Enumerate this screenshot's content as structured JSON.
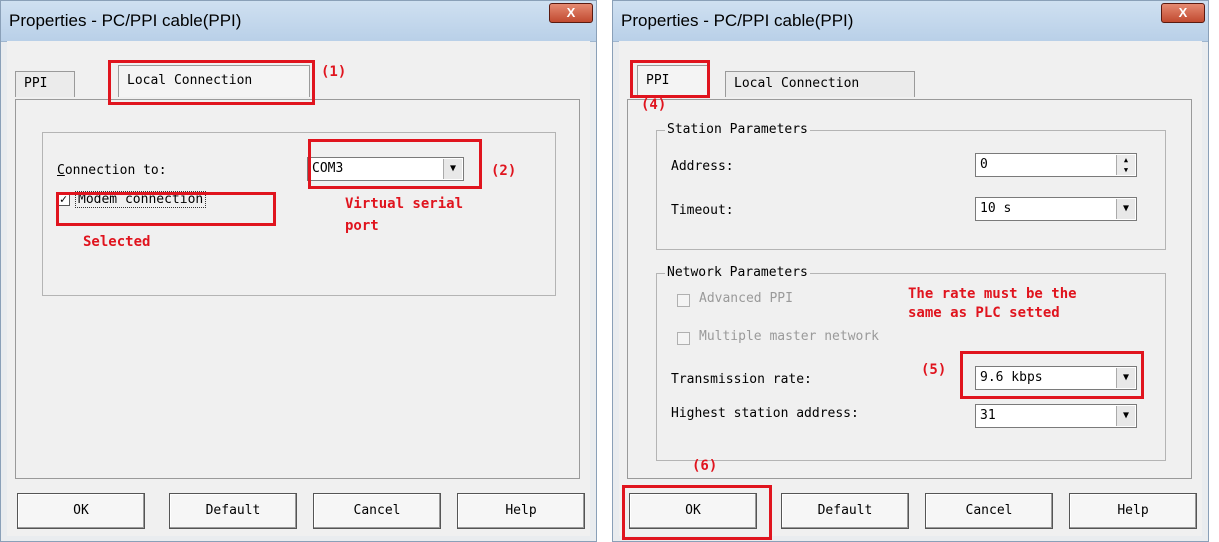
{
  "left_dialog": {
    "title": "Properties - PC/PPI cable(PPI)",
    "close_glyph": "X",
    "tabs": [
      {
        "label": "PPI"
      },
      {
        "label": "Local Connection"
      }
    ],
    "connection_to_label": "Connection to:",
    "connection_value": "COM3",
    "modem_label": "Modem connection",
    "modem_checked": true,
    "buttons": {
      "ok": "OK",
      "default": "Default",
      "cancel": "Cancel",
      "help": "Help"
    }
  },
  "right_dialog": {
    "title": "Properties - PC/PPI cable(PPI)",
    "close_glyph": "X",
    "tabs": [
      {
        "label": "PPI"
      },
      {
        "label": "Local Connection"
      }
    ],
    "station_group": "Station Parameters",
    "address_label": "Address:",
    "address_value": "0",
    "timeout_label": "Timeout:",
    "timeout_value": "10 s",
    "network_group": "Network Parameters",
    "advanced_ppi_label": "Advanced PPI",
    "multiple_master_label": "Multiple master network",
    "transmission_rate_label": "Transmission rate:",
    "transmission_rate_value": "9.6 kbps",
    "highest_station_label": "Highest station address:",
    "highest_station_value": "31",
    "buttons": {
      "ok": "OK",
      "default": "Default",
      "cancel": "Cancel",
      "help": "Help"
    }
  },
  "annotations": {
    "n1": "(1)",
    "n2": "(2)",
    "n4": "(4)",
    "n5": "(5)",
    "n6": "(6)",
    "virtual_serial": "Virtual serial",
    "virtual_serial_2": "port",
    "selected": "Selected",
    "rate_note_1": "The rate must be the",
    "rate_note_2": "same as PLC setted"
  },
  "colors": {
    "annotation_red": "#e0141e"
  }
}
